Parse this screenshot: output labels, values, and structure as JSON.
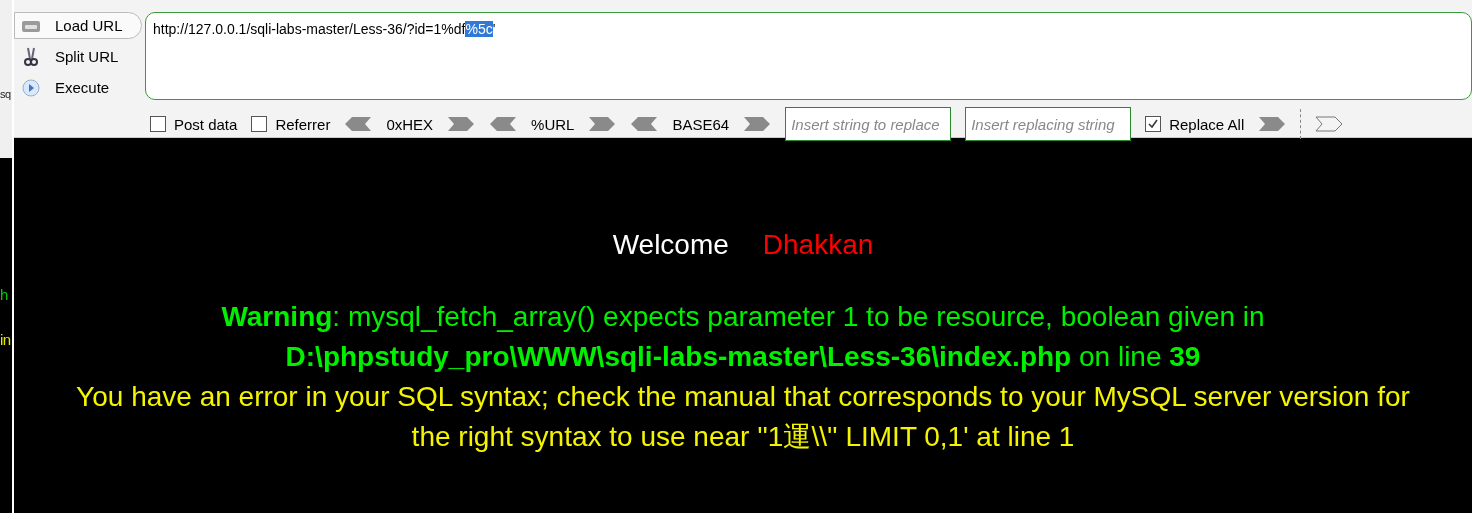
{
  "side_fragments": [
    {
      "text": "sq",
      "kind": "plain"
    },
    {
      "text": "h",
      "kind": "warning"
    },
    {
      "text": "in",
      "kind": "error"
    }
  ],
  "actions": [
    {
      "label": "Load URL",
      "kind": "load",
      "selected": true
    },
    {
      "label": "Split URL",
      "kind": "split",
      "selected": false
    },
    {
      "label": "Execute",
      "kind": "execute",
      "selected": false
    }
  ],
  "url": {
    "before": "http://127.0.0.1/sqli-labs-master/Less-36/?id=1%df",
    "selected_text": "%5c",
    "after": "'"
  },
  "options": [
    {
      "label": "Post data",
      "checked": false
    },
    {
      "label": "Referrer",
      "checked": false
    }
  ],
  "encoders": [
    "0xHEX",
    "%URL",
    "BASE64"
  ],
  "replace": {
    "find_placeholder": "Insert string to replace",
    "with_placeholder": "Insert replacing string",
    "label": "Replace All",
    "checked": true
  },
  "page": {
    "welcome": "Welcome",
    "name": "Dhakkan",
    "warning": "**Warning**: mysql_fetch_array() expects parameter 1 to be resource, boolean given in **D:\\phpstudy_pro\\WWW\\sqli-labs-master\\Less-36\\index.php** on line **39**",
    "error": "You have an error in your SQL syntax; check the manual that corresponds to your MySQL server version for the right syntax to use near ''1運\\\\'' LIMIT 0,1' at line 1"
  }
}
